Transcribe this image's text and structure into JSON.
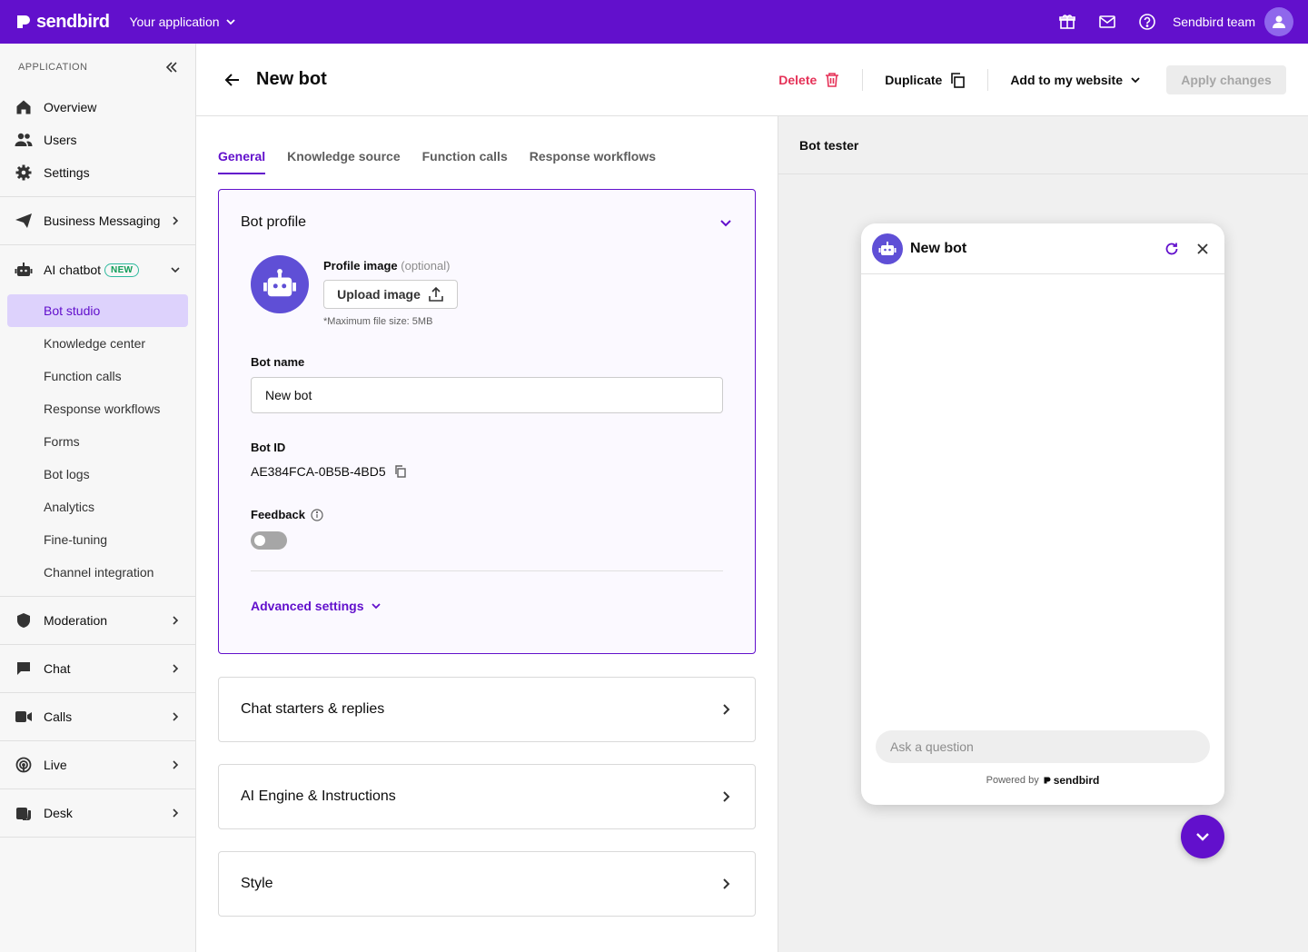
{
  "topbar": {
    "brand": "sendbird",
    "app_selector": "Your application",
    "team_name": "Sendbird team",
    "icons": [
      "gift-icon",
      "mail-icon",
      "help-icon",
      "user-icon"
    ]
  },
  "sidebar": {
    "section_label": "APPLICATION",
    "top_items": [
      {
        "label": "Overview",
        "icon": "home-icon"
      },
      {
        "label": "Users",
        "icon": "users-icon"
      },
      {
        "label": "Settings",
        "icon": "gear-icon"
      }
    ],
    "business_messaging": "Business Messaging",
    "ai_chatbot": {
      "label": "AI chatbot",
      "badge": "NEW"
    },
    "ai_sub_items": [
      {
        "label": "Bot studio",
        "active": true
      },
      {
        "label": "Knowledge center"
      },
      {
        "label": "Function calls"
      },
      {
        "label": "Response workflows"
      },
      {
        "label": "Forms"
      },
      {
        "label": "Bot logs"
      },
      {
        "label": "Analytics"
      },
      {
        "label": "Fine-tuning"
      },
      {
        "label": "Channel integration"
      }
    ],
    "groups": [
      {
        "label": "Moderation",
        "icon": "shield-icon"
      },
      {
        "label": "Chat",
        "icon": "chat-icon"
      },
      {
        "label": "Calls",
        "icon": "video-icon"
      },
      {
        "label": "Live",
        "icon": "broadcast-icon"
      },
      {
        "label": "Desk",
        "icon": "desk-icon"
      }
    ]
  },
  "header": {
    "title": "New bot",
    "delete_label": "Delete",
    "duplicate_label": "Duplicate",
    "add_to_website_label": "Add to my website",
    "apply_label": "Apply changes"
  },
  "tabs": [
    {
      "label": "General",
      "active": true
    },
    {
      "label": "Knowledge source"
    },
    {
      "label": "Function calls"
    },
    {
      "label": "Response workflows"
    }
  ],
  "bot_profile": {
    "title": "Bot profile",
    "profile_image_label": "Profile image",
    "profile_image_optional": "(optional)",
    "upload_label": "Upload image",
    "max_size_hint": "*Maximum file size: 5MB",
    "bot_name_label": "Bot name",
    "bot_name_value": "New bot",
    "bot_id_label": "Bot ID",
    "bot_id_value": "AE384FCA-0B5B-4BD5",
    "feedback_label": "Feedback",
    "feedback_enabled": false,
    "advanced_label": "Advanced settings"
  },
  "collapsed_cards": [
    {
      "label": "Chat starters & replies"
    },
    {
      "label": "AI Engine & Instructions"
    },
    {
      "label": "Style"
    }
  ],
  "bot_tester": {
    "title": "Bot tester",
    "widget_title": "New bot",
    "input_placeholder": "Ask a question",
    "powered_by": "Powered by",
    "powered_brand": "sendbird"
  },
  "colors": {
    "brand_purple": "#6210cc",
    "bot_avatar": "#5f4fd6",
    "delete_red": "#e53157",
    "active_nav_bg": "#ddd2fc"
  }
}
